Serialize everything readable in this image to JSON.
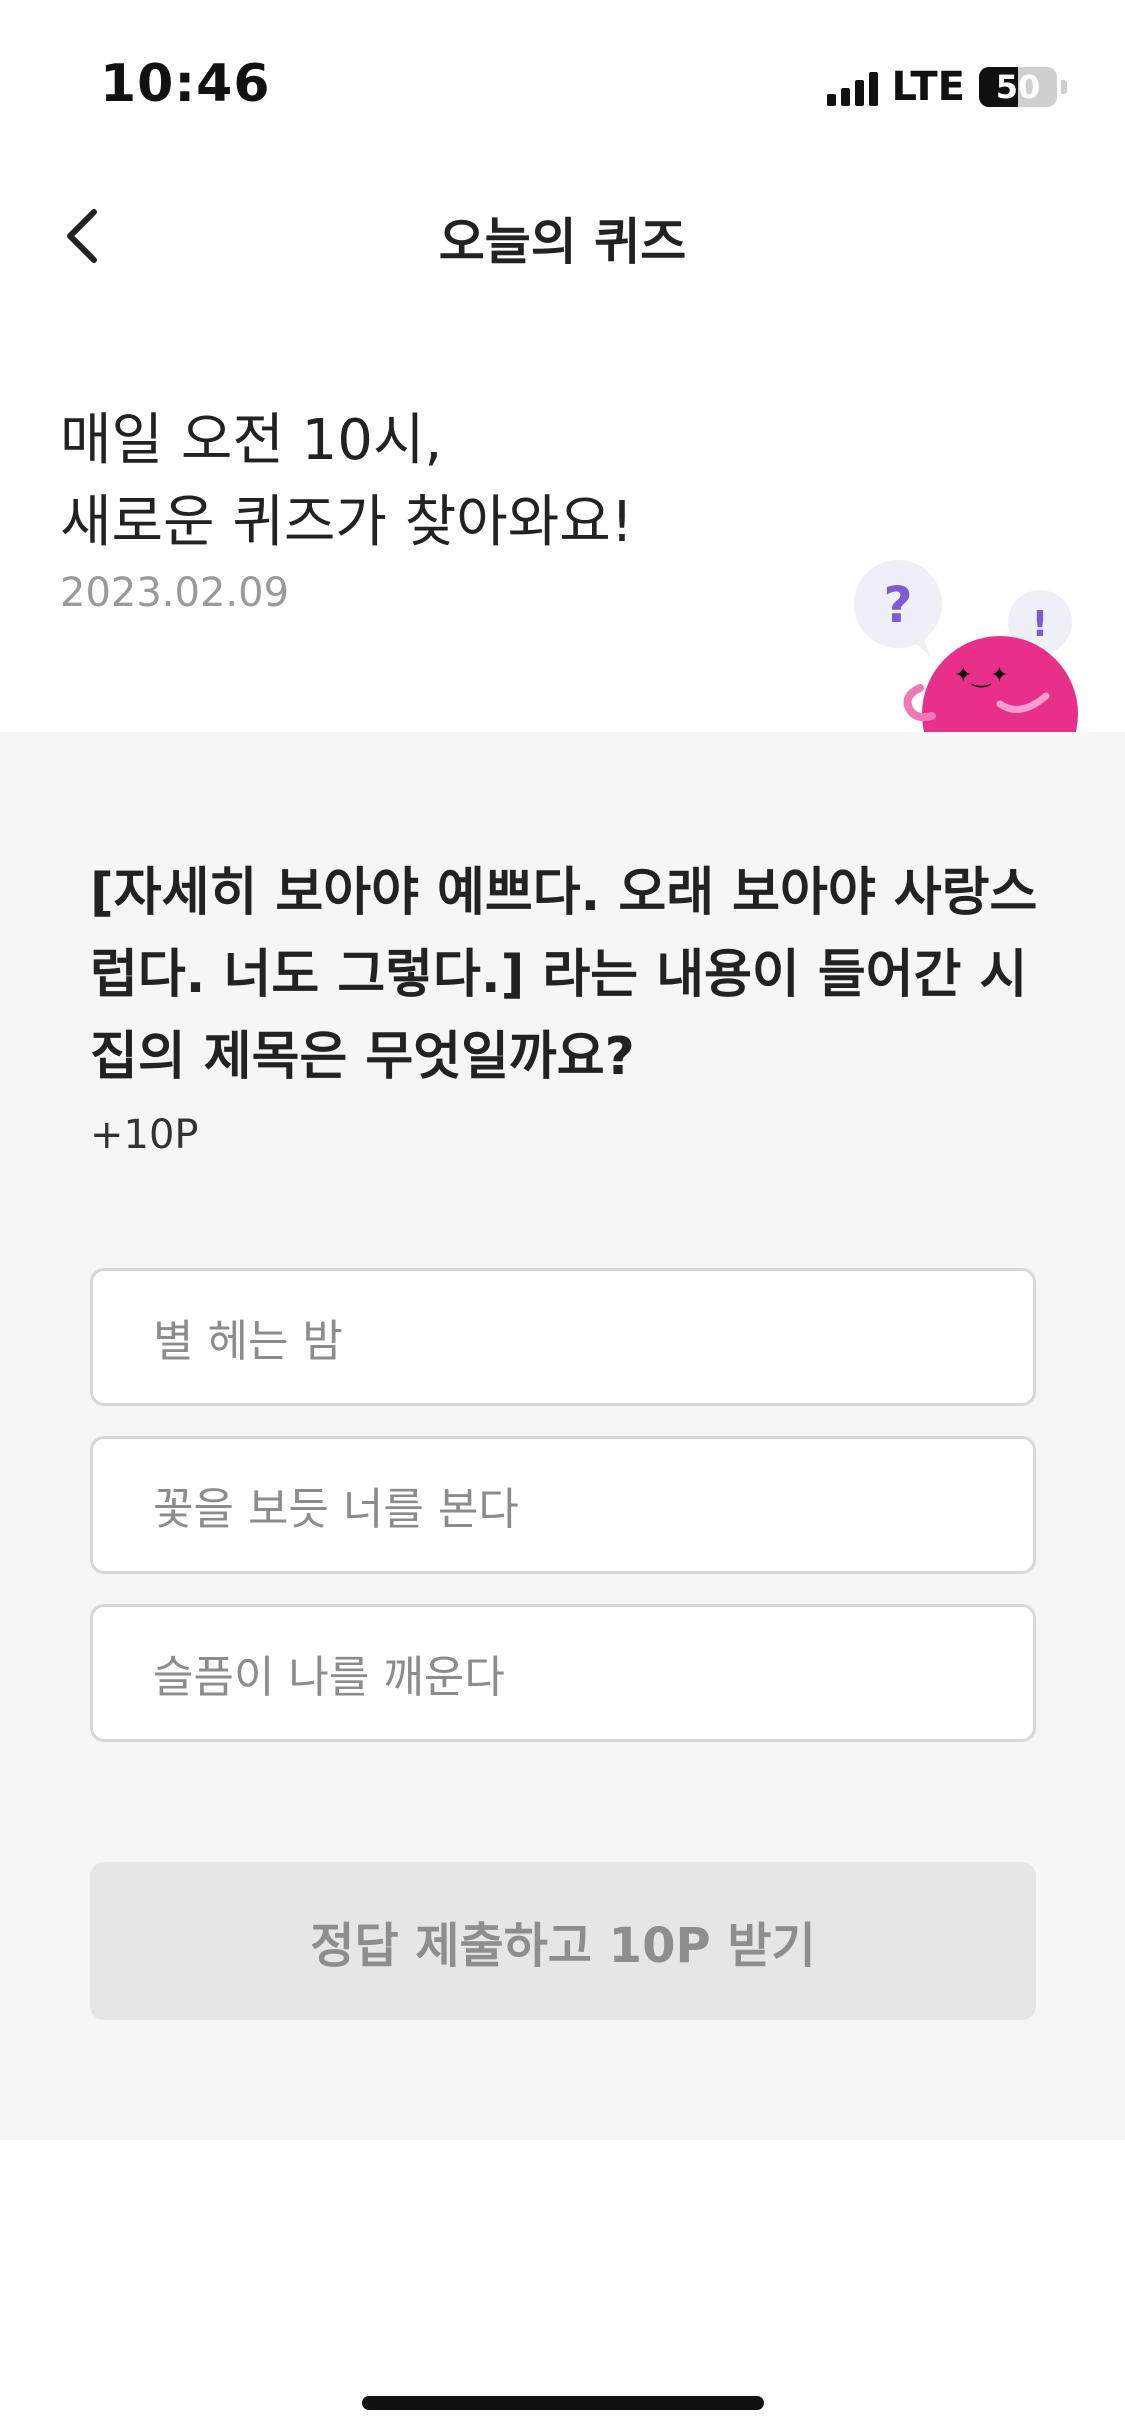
{
  "status_bar": {
    "time": "10:46",
    "network": "LTE",
    "battery": "50",
    "battery_level": 0.5
  },
  "header": {
    "title": "오늘의 퀴즈",
    "back_icon": "chevron-left-icon"
  },
  "intro": {
    "line1": "매일 오전 10시,",
    "line2": "새로운 퀴즈가 찾아와요!",
    "date": "2023.02.09"
  },
  "mascot": {
    "question_mark": "?",
    "exclaim_mark": "!",
    "colors": {
      "body": "#e8308a",
      "bubble": "#efeff7",
      "question": "#7b5bd6"
    }
  },
  "quiz": {
    "question": "[자세히 보아야 예쁘다. 오래 보아야 사랑스럽다. 너도 그렇다.] 라는 내용이 들어간 시집의 제목은 무엇일까요?",
    "points": "+10P",
    "options": [
      {
        "label": "별 헤는 밤"
      },
      {
        "label": "꽃을 보듯 너를 본다"
      },
      {
        "label": "슬픔이 나를 깨운다"
      }
    ],
    "submit_label": "정답 제출하고 10P 받기"
  }
}
